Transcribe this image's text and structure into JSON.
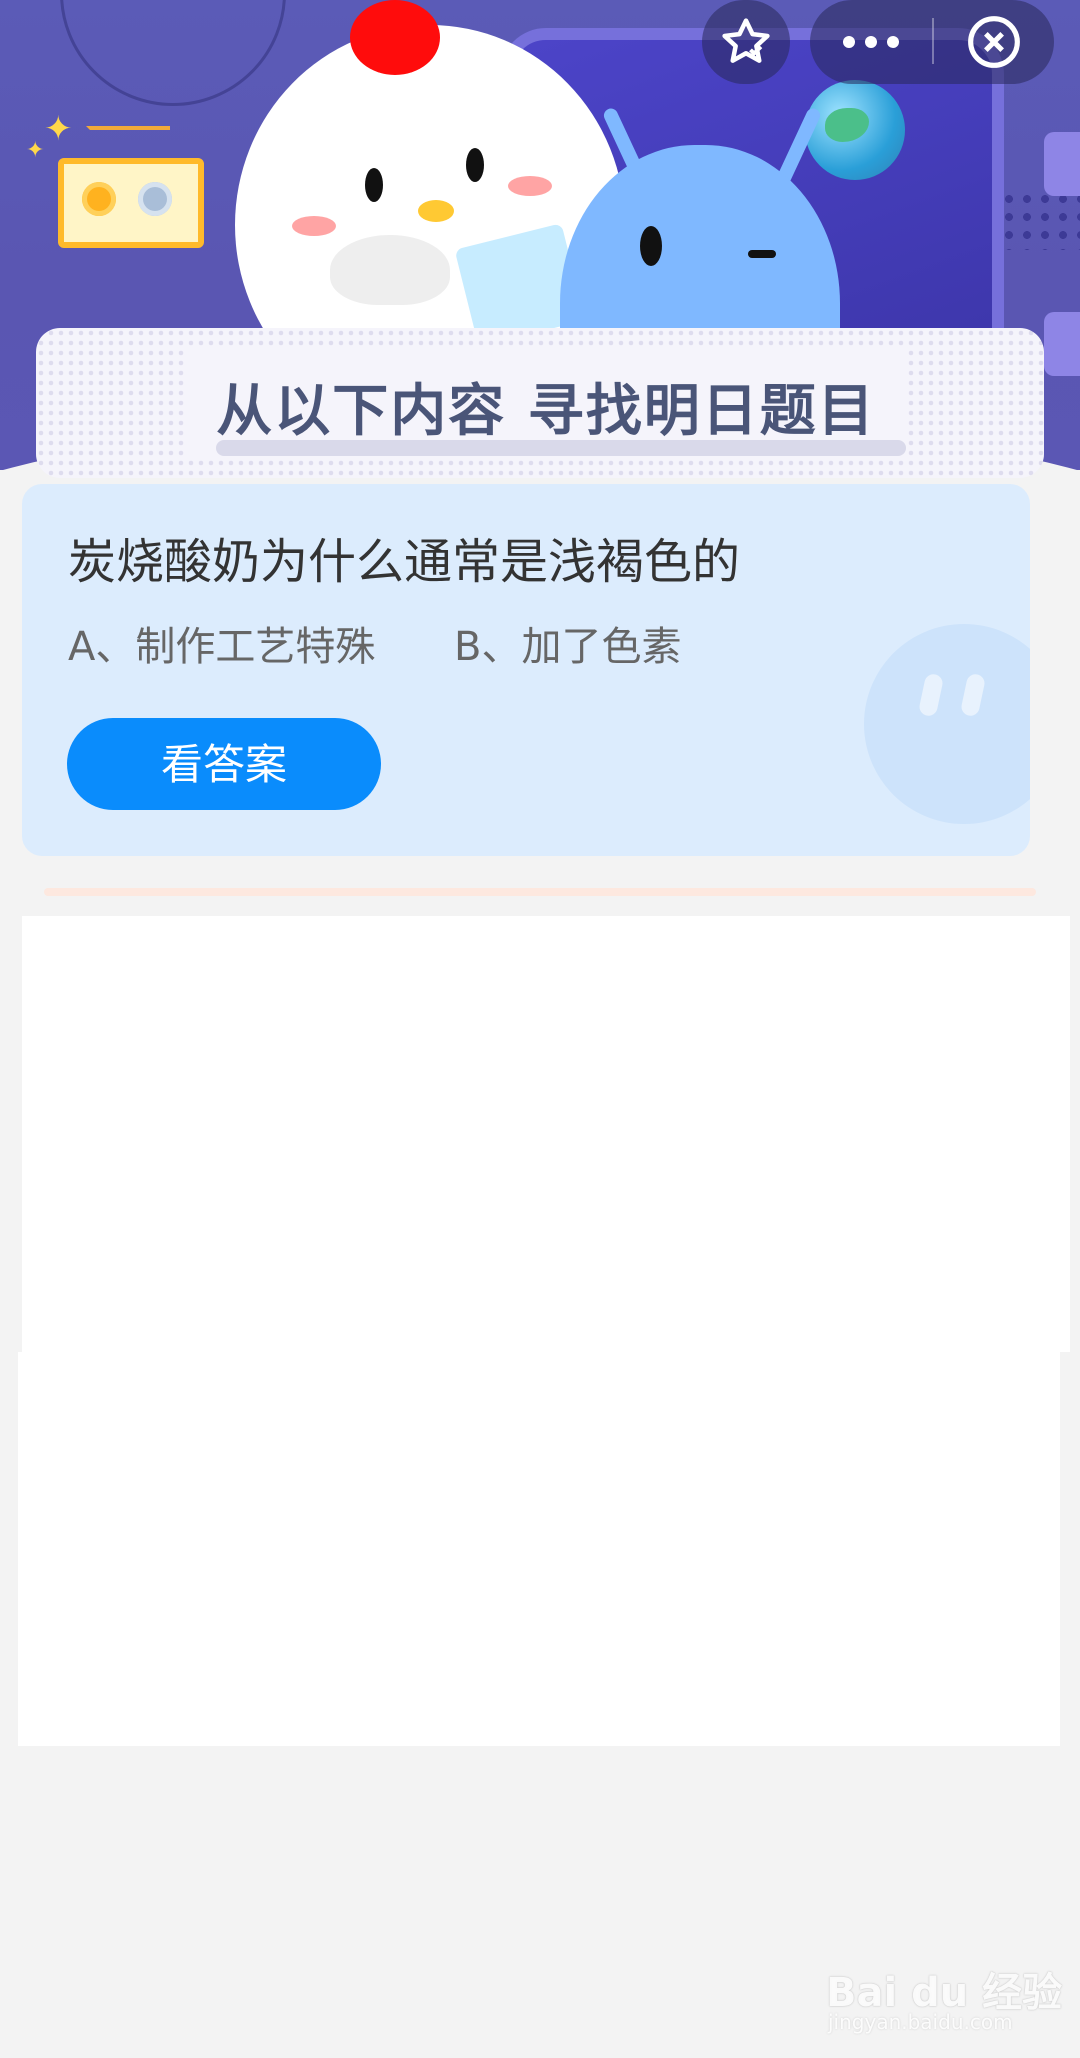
{
  "banner": {
    "title": "从以下内容  寻找明日题目"
  },
  "question": {
    "text": "炭烧酸奶为什么通常是浅褐色的",
    "option_a": "A、制作工艺特殊",
    "option_b": "B、加了色素",
    "answer_button": "看答案"
  },
  "top_bar": {
    "favorite_icon": "star-check-icon",
    "more_icon": "more-dots-icon",
    "close_icon": "close-circle-icon"
  },
  "watermark": {
    "brand": "Bai du 经验",
    "url": "jingyan.baidu.com"
  },
  "colors": {
    "hero_bg": "#5b5bb7",
    "card_bg": "#dcecfd",
    "button_bg": "#0a8cfc",
    "page_bg": "#f3f3f3"
  }
}
